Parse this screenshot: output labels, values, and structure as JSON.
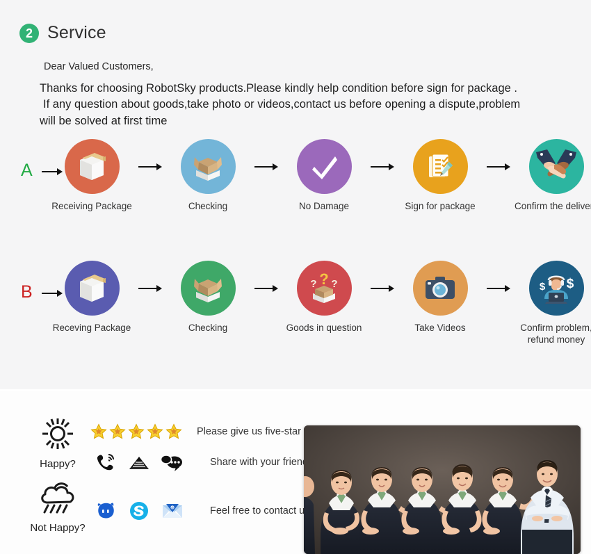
{
  "service": {
    "badge_number": "2",
    "title": "Service",
    "greeting": "Dear Valued Customers,",
    "paragraph_line1": "Thanks for choosing RobotSky products.Please kindly help condition before sign for package .",
    "paragraph_line2": "If any question about goods,take photo or videos,contact us before opening a dispute,problem",
    "paragraph_line3": "will be solved at first time"
  },
  "flows": [
    {
      "letter": "A",
      "letter_color": "#22aa44",
      "steps": [
        {
          "label": "Receiving Package",
          "icon": "sealed-box-icon",
          "color": "#d9684a"
        },
        {
          "label": "Checking",
          "icon": "open-box-icon",
          "color": "#73b5d8"
        },
        {
          "label": "No Damage",
          "icon": "checkmark-icon",
          "color": "#9b69bb"
        },
        {
          "label": "Sign for package",
          "icon": "signed-document-icon",
          "color": "#e8a21d"
        },
        {
          "label": "Confirm the delivery",
          "icon": "handshake-icon",
          "color": "#2cb5a0"
        }
      ]
    },
    {
      "letter": "B",
      "letter_color": "#cc2222",
      "steps": [
        {
          "label": "Receving Package",
          "icon": "sealed-box-icon",
          "color": "#5a5cb0"
        },
        {
          "label": "Checking",
          "icon": "open-box-icon",
          "color": "#3fa868"
        },
        {
          "label": "Goods in question",
          "icon": "question-box-icon",
          "color": "#cf4a4e"
        },
        {
          "label": "Take Videos",
          "icon": "camera-icon",
          "color": "#e09c52"
        },
        {
          "label": "Confirm problem,\nrefund money",
          "icon": "support-agent-icon",
          "color": "#1d5d84"
        }
      ]
    }
  ],
  "contact": {
    "happy_label": "Happy?",
    "happy_icon": "sun-icon",
    "not_happy_label": "Not Happy?",
    "not_happy_icon": "rain-cloud-icon",
    "star_count": 5,
    "star_icon": "star-icon",
    "line_five_star": "Please give us five-star",
    "line_share": "Share with your friends",
    "line_contact": "Feel free to contact us",
    "share_icons": [
      "phone-ring-icon",
      "envelope-icon",
      "chat-bubble-icon"
    ],
    "contact_icons": [
      "aliwangwang-icon",
      "skype-icon",
      "email-icon"
    ],
    "photo_alt": "customer-service-team-photo"
  }
}
